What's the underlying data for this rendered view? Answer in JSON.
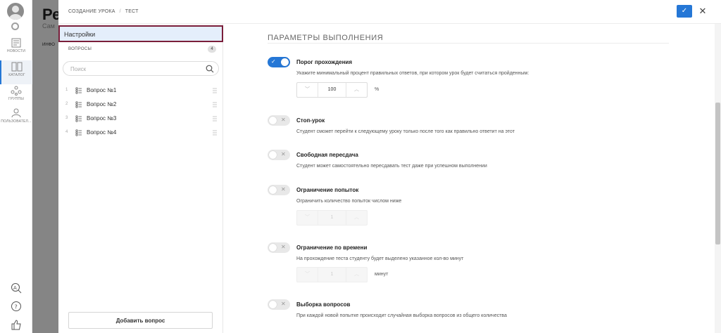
{
  "nav": {
    "items": [
      {
        "label": "НОВОСТИ",
        "icon": "news-icon"
      },
      {
        "label": "КАТАЛОГ",
        "icon": "catalog-icon"
      },
      {
        "label": "ГРУППЫ",
        "icon": "groups-icon"
      },
      {
        "label": "ПОЛЬЗОВАТЕЛ...",
        "icon": "users-icon"
      }
    ],
    "bottom_icons": [
      "translate-icon",
      "help-icon",
      "like-icon"
    ]
  },
  "background_page": {
    "title": "Ре",
    "subtitle": "Сам",
    "tab": "ИНФО"
  },
  "header": {
    "breadcrumb": [
      "СОЗДАНИЕ УРОКА",
      "ТЕСТ"
    ],
    "confirm_icon": "check-icon",
    "close_icon": "close-icon"
  },
  "sidebar": {
    "settings_label": "Настройки",
    "questions_header": "ВОПРОСЫ",
    "questions_count": "4",
    "search_placeholder": "Поиск",
    "questions": [
      {
        "num": "1",
        "label": "Вопрос №1"
      },
      {
        "num": "2",
        "label": "Вопрос №2"
      },
      {
        "num": "3",
        "label": "Вопрос №3"
      },
      {
        "num": "4",
        "label": "Вопрос №4"
      }
    ],
    "add_button": "Добавить вопрос"
  },
  "content": {
    "section_title": "ПАРАМЕТРЫ ВЫПОЛНЕНИЯ",
    "options": [
      {
        "title": "Порог прохождения",
        "desc": "Укажите минимальный процент правильных ответов, при котором урок будет считаться пройденным:",
        "enabled": true,
        "stepper_value": "100",
        "unit": "%"
      },
      {
        "title": "Стоп-урок",
        "desc": "Студент сможет перейти к следующему уроку только после того как правильно ответит на этот",
        "enabled": false
      },
      {
        "title": "Свободная пересдача",
        "desc": "Студент может самостоятельно пересдавать тест даже при успешном выполнении",
        "enabled": false
      },
      {
        "title": "Ограничение попыток",
        "desc": "Ограничить количество попыток числом ниже",
        "enabled": false,
        "stepper_value": "1"
      },
      {
        "title": "Ограничение по времени",
        "desc": "На прохождение теста студенту будет выделено указанное кол-во минут",
        "enabled": false,
        "stepper_value": "1",
        "unit": "минут"
      },
      {
        "title": "Выборка вопросов",
        "desc": "При каждой новой попытке происходит случайная выборка вопросов из общего количества",
        "enabled": false
      }
    ]
  },
  "colors": {
    "accent": "#2577d6",
    "highlight_border": "#7a1e3a",
    "selected_bg": "#e4eefb"
  }
}
